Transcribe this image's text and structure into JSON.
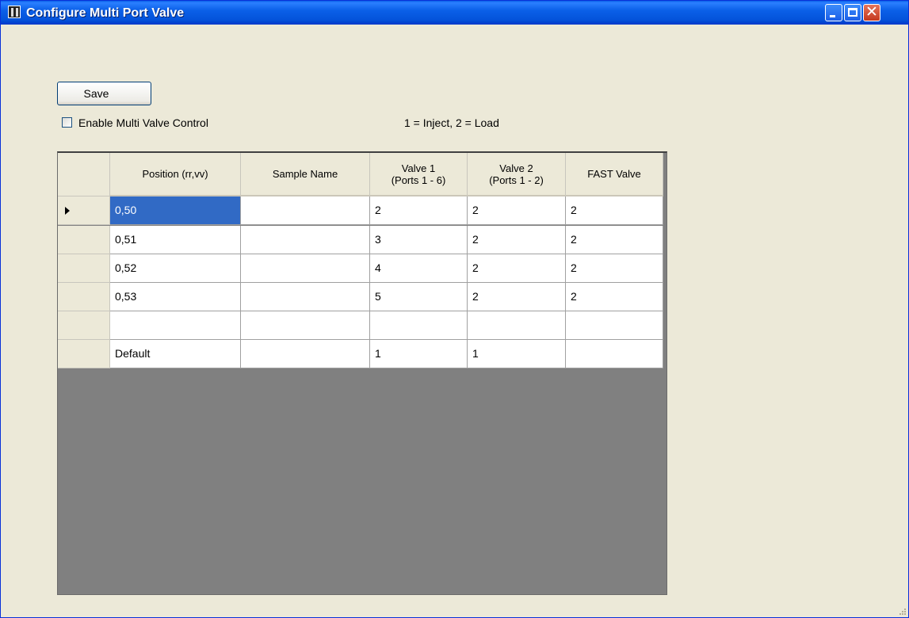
{
  "window": {
    "title": "Configure Multi Port Valve"
  },
  "toolbar": {
    "save_label": "Save",
    "enable_label": "Enable Multi Valve Control",
    "enable_checked": false,
    "legend": "1 = Inject, 2 = Load"
  },
  "grid": {
    "columns": [
      {
        "line1": "Position (rr,vv)",
        "line2": ""
      },
      {
        "line1": "Sample Name",
        "line2": ""
      },
      {
        "line1": "Valve 1",
        "line2": "(Ports 1 - 6)"
      },
      {
        "line1": "Valve 2",
        "line2": "(Ports 1 - 2)"
      },
      {
        "line1": "FAST Valve",
        "line2": ""
      }
    ],
    "rows": [
      [
        "0,50",
        "",
        "2",
        "2",
        "2"
      ],
      [
        "0,51",
        "",
        "3",
        "2",
        "2"
      ],
      [
        "0,52",
        "",
        "4",
        "2",
        "2"
      ],
      [
        "0,53",
        "",
        "5",
        "2",
        "2"
      ],
      [
        "",
        "",
        "",
        "",
        ""
      ],
      [
        "Default",
        "",
        "1",
        "1",
        ""
      ]
    ],
    "selected_row": 0,
    "selected_col": 0
  }
}
